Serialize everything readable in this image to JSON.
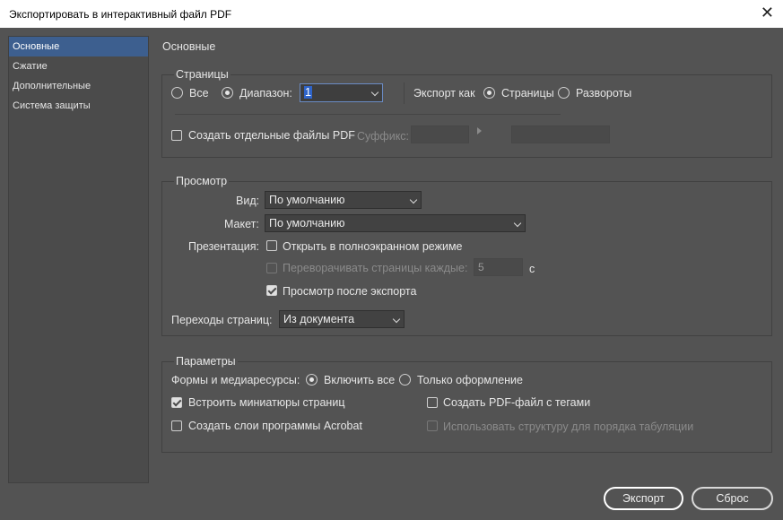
{
  "window": {
    "title": "Экспортировать в интерактивный файл PDF",
    "close_glyph": "✕"
  },
  "sidebar": {
    "items": [
      {
        "label": "Основные",
        "active": true
      },
      {
        "label": "Сжатие"
      },
      {
        "label": "Дополнительные"
      },
      {
        "label": "Система защиты"
      }
    ]
  },
  "main": {
    "heading": "Основные"
  },
  "pages": {
    "heading": "Страницы",
    "all_label": "Все",
    "range_label": "Диапазон:",
    "range_value": "1",
    "export_as_label": "Экспорт как",
    "pages_label": "Страницы",
    "spreads_label": "Развороты",
    "separate_files_label": "Создать отдельные файлы PDF",
    "suffix_label": "Суффикс:",
    "suffix_value": "",
    "suffix_extra_value": ""
  },
  "view": {
    "heading": "Просмотр",
    "view_label": "Вид:",
    "view_value": "По умолчанию",
    "layout_label": "Макет:",
    "layout_value": "По умолчанию",
    "presentation_label": "Презентация:",
    "fullscreen_label": "Открыть в полноэкранном режиме",
    "flip_label": "Переворачивать страницы каждые:",
    "flip_value": "5",
    "flip_unit": "с",
    "view_after_export_label": "Просмотр после экспорта",
    "transitions_label": "Переходы страниц:",
    "transitions_value": "Из документа"
  },
  "options": {
    "heading": "Параметры",
    "forms_label": "Формы и медиаресурсы:",
    "include_all_label": "Включить все",
    "appearance_only_label": "Только оформление",
    "embed_thumbs_label": "Встроить миниатюры страниц",
    "tagged_pdf_label": "Создать PDF-файл с тегами",
    "acrobat_layers_label": "Создать слои программы Acrobat",
    "tab_order_label": "Использовать структуру для порядка табуляции"
  },
  "buttons": {
    "export_label": "Экспорт",
    "reset_label": "Сброс"
  }
}
